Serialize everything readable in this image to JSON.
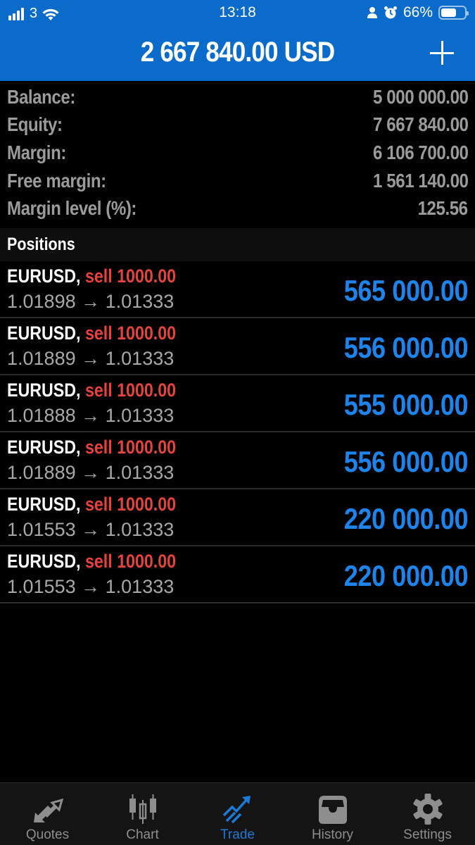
{
  "status_bar": {
    "carrier": "3",
    "time": "13:18",
    "battery_percent_label": "66%",
    "battery_level": 0.66,
    "icons": [
      "signal-icon",
      "wifi-icon",
      "person-icon",
      "alarm-icon",
      "battery-icon"
    ]
  },
  "header": {
    "title": "2 667 840.00 USD",
    "add_button_icon": "plus-icon"
  },
  "summary": [
    {
      "label": "Balance:",
      "value": "5 000 000.00"
    },
    {
      "label": "Equity:",
      "value": "7 667 840.00"
    },
    {
      "label": "Margin:",
      "value": "6 106 700.00"
    },
    {
      "label": "Free margin:",
      "value": "1 561 140.00"
    },
    {
      "label": "Margin level (%):",
      "value": "125.56"
    }
  ],
  "positions": {
    "title": "Positions",
    "items": [
      {
        "symbol": "EURUSD,",
        "type": "sell 1000.00",
        "open": "1.01898",
        "arrow": "→",
        "current": "1.01333",
        "profit": "565 000.00"
      },
      {
        "symbol": "EURUSD,",
        "type": "sell 1000.00",
        "open": "1.01889",
        "arrow": "→",
        "current": "1.01333",
        "profit": "556 000.00"
      },
      {
        "symbol": "EURUSD,",
        "type": "sell 1000.00",
        "open": "1.01888",
        "arrow": "→",
        "current": "1.01333",
        "profit": "555 000.00"
      },
      {
        "symbol": "EURUSD,",
        "type": "sell 1000.00",
        "open": "1.01889",
        "arrow": "→",
        "current": "1.01333",
        "profit": "556 000.00"
      },
      {
        "symbol": "EURUSD,",
        "type": "sell 1000.00",
        "open": "1.01553",
        "arrow": "→",
        "current": "1.01333",
        "profit": "220 000.00"
      },
      {
        "symbol": "EURUSD,",
        "type": "sell 1000.00",
        "open": "1.01553",
        "arrow": "→",
        "current": "1.01333",
        "profit": "220 000.00"
      }
    ]
  },
  "tabbar": {
    "active": "Trade",
    "tabs": [
      {
        "label": "Quotes",
        "icon": "quotes-arrows-icon"
      },
      {
        "label": "Chart",
        "icon": "candlestick-chart-icon"
      },
      {
        "label": "Trade",
        "icon": "trade-trend-icon"
      },
      {
        "label": "History",
        "icon": "inbox-tray-icon"
      },
      {
        "label": "Settings",
        "icon": "gear-icon"
      }
    ]
  },
  "colors": {
    "brand_blue": "#0b6bcb",
    "profit_blue": "#1d84ec",
    "sell_red": "#e5433c",
    "active_tab": "#1d7ad6",
    "inactive_tab": "#8e8e8e"
  }
}
